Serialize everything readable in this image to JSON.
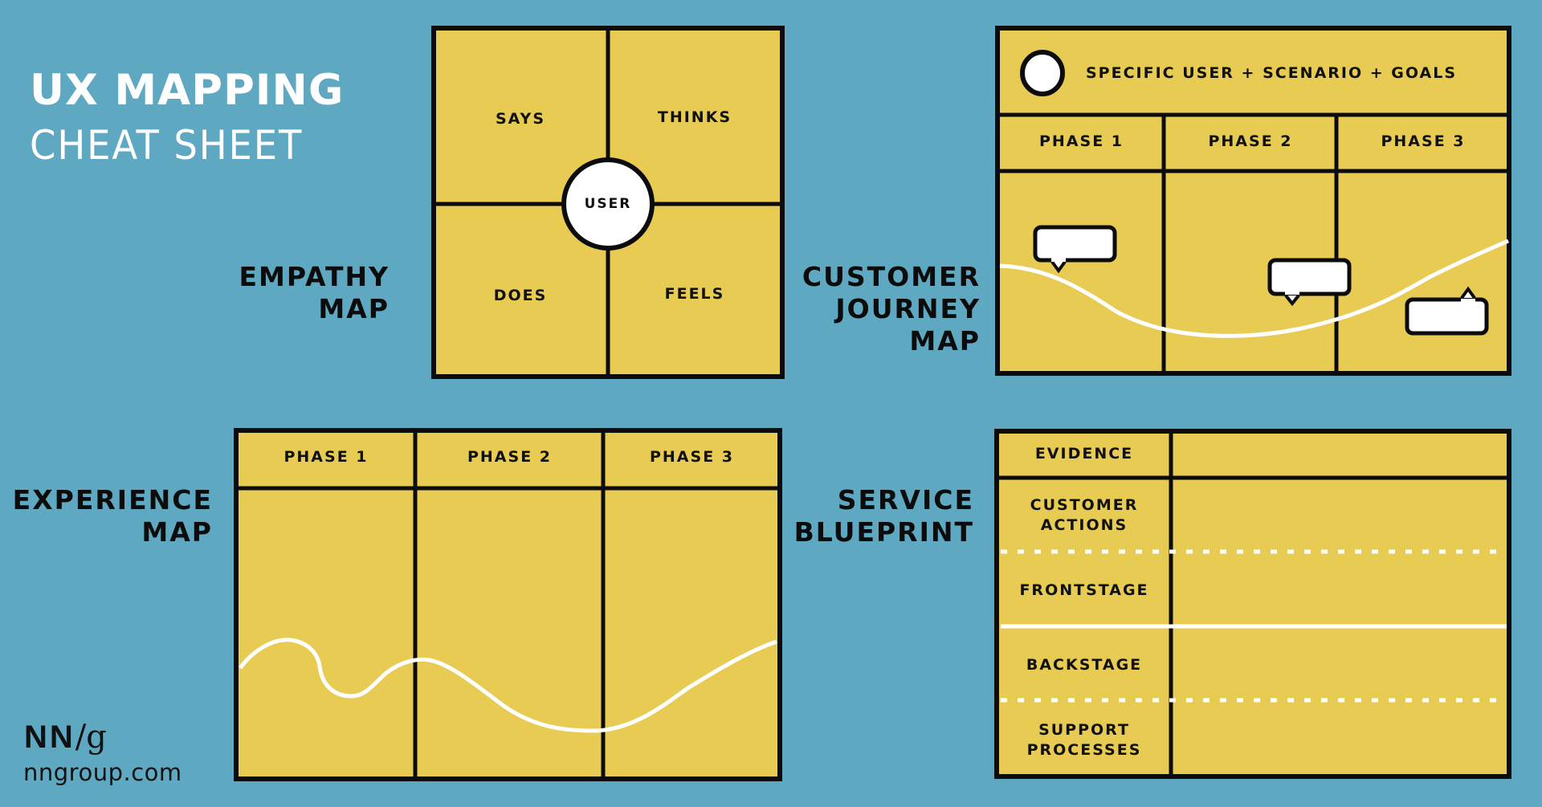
{
  "header": {
    "title": "UX MAPPING",
    "subtitle": "CHEAT SHEET"
  },
  "colors": {
    "background": "#5FA8C1",
    "card": "#E8CB53",
    "ink": "#0C0C0C",
    "line": "#FFFFFF"
  },
  "empathy_map": {
    "label_lines": [
      "EMPATHY",
      "MAP"
    ],
    "quadrants": [
      "SAYS",
      "THINKS",
      "DOES",
      "FEELS"
    ],
    "center": "USER"
  },
  "customer_journey_map": {
    "label_lines": [
      "CUSTOMER",
      "JOURNEY",
      "MAP"
    ],
    "persona_header": "SPECIFIC USER + SCENARIO + GOALS",
    "persona_icon": "user-circle-icon",
    "phases": [
      "PHASE 1",
      "PHASE 2",
      "PHASE 3"
    ],
    "bubble_icons": [
      "speech-bubble-icon",
      "speech-bubble-icon",
      "speech-bubble-icon"
    ]
  },
  "experience_map": {
    "label_lines": [
      "EXPERIENCE",
      "MAP"
    ],
    "phases": [
      "PHASE 1",
      "PHASE 2",
      "PHASE 3"
    ]
  },
  "service_blueprint": {
    "label_lines": [
      "SERVICE",
      "BLUEPRINT"
    ],
    "rows": [
      "EVIDENCE",
      "CUSTOMER ACTIONS",
      "FRONTSTAGE",
      "BACKSTAGE",
      "SUPPORT PROCESSES"
    ],
    "row_label_lines": [
      [
        "EVIDENCE"
      ],
      [
        "CUSTOMER",
        "ACTIONS"
      ],
      [
        "FRONTSTAGE"
      ],
      [
        "BACKSTAGE"
      ],
      [
        "SUPPORT",
        "PROCESSES"
      ]
    ],
    "line_types": [
      "solid",
      "dashed",
      "solid-white",
      "dashed"
    ]
  },
  "footer": {
    "logo_left": "NN",
    "logo_slash": "/",
    "logo_right": "g",
    "website": "nngroup.com"
  }
}
